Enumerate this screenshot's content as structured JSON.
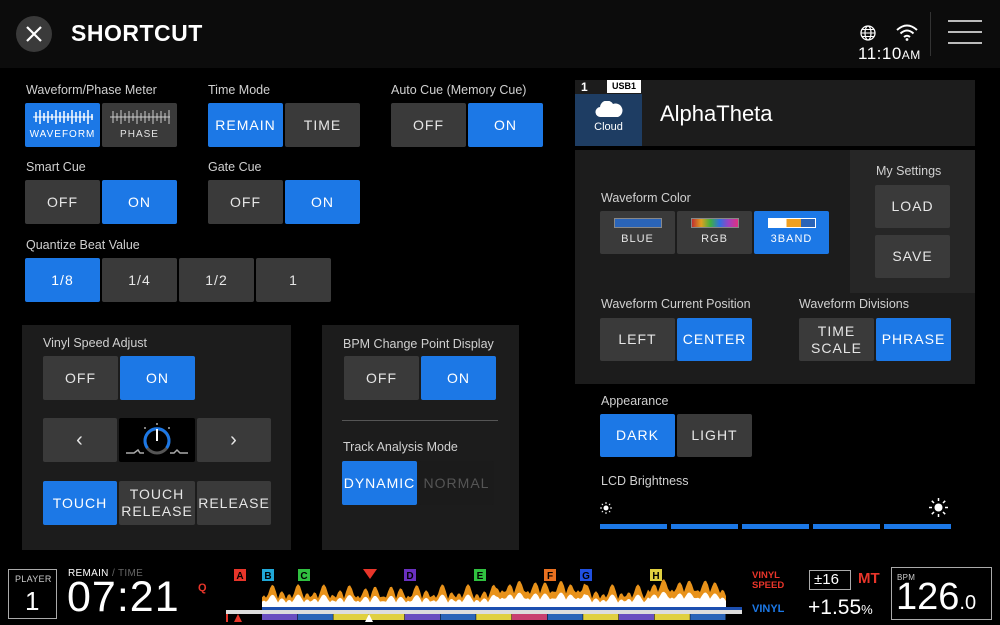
{
  "header": {
    "title": "SHORTCUT",
    "time": "11:10",
    "ampm": "AM"
  },
  "waveform_phase_meter": {
    "label": "Waveform/Phase Meter",
    "options": [
      "WAVEFORM",
      "PHASE"
    ],
    "selected": "WAVEFORM"
  },
  "time_mode": {
    "label": "Time Mode",
    "options": [
      "REMAIN",
      "TIME"
    ],
    "selected": "REMAIN"
  },
  "auto_cue": {
    "label": "Auto Cue (Memory Cue)",
    "options": [
      "OFF",
      "ON"
    ],
    "selected": "ON"
  },
  "smart_cue": {
    "label": "Smart Cue",
    "options": [
      "OFF",
      "ON"
    ],
    "selected": "ON"
  },
  "gate_cue": {
    "label": "Gate Cue",
    "options": [
      "OFF",
      "ON"
    ],
    "selected": "ON"
  },
  "quantize": {
    "label": "Quantize Beat Value",
    "options": [
      "1/8",
      "1/4",
      "1/2",
      "1"
    ],
    "selected": "1/8"
  },
  "vinyl_speed": {
    "label": "Vinyl Speed Adjust",
    "options": [
      "OFF",
      "ON"
    ],
    "selected": "ON",
    "prev": "‹",
    "next": "›",
    "modes": [
      "TOUCH",
      "TOUCH RELEASE",
      "RELEASE"
    ],
    "mode_selected": "TOUCH"
  },
  "bpm_change": {
    "label": "BPM Change Point Display",
    "options": [
      "OFF",
      "ON"
    ],
    "selected": "ON"
  },
  "track_analysis": {
    "label": "Track Analysis Mode",
    "options": [
      "DYNAMIC",
      "NORMAL"
    ],
    "selected": "DYNAMIC"
  },
  "deck": {
    "number": "1",
    "usb": "USB1",
    "source": "Cloud",
    "name": "AlphaTheta"
  },
  "waveform_color": {
    "label": "Waveform Color",
    "options": [
      "BLUE",
      "RGB",
      "3BAND"
    ],
    "selected": "3BAND"
  },
  "my_settings": {
    "label": "My Settings",
    "load": "LOAD",
    "save": "SAVE"
  },
  "waveform_position": {
    "label": "Waveform Current Position",
    "options": [
      "LEFT",
      "CENTER"
    ],
    "selected": "CENTER"
  },
  "waveform_divisions": {
    "label": "Waveform Divisions",
    "options": [
      "TIME SCALE",
      "PHRASE"
    ],
    "selected": "PHRASE"
  },
  "appearance": {
    "label": "Appearance",
    "options": [
      "DARK",
      "LIGHT"
    ],
    "selected": "DARK"
  },
  "lcd_brightness": {
    "label": "LCD Brightness",
    "level": 5,
    "max": 5
  },
  "status_bar": {
    "player_label": "PLAYER",
    "player_number": "1",
    "remain_label": "REMAIN",
    "time_label": "/ TIME",
    "time_value": "07:21",
    "quantize_q": "Q",
    "hot_cues": [
      "A",
      "B",
      "C",
      "D",
      "E",
      "F",
      "G",
      "H"
    ],
    "vinyl_speed": "VINYL SPEED",
    "vinyl": "VINYL",
    "tempo_range": "±16",
    "master_tempo": "MT",
    "tempo": "+1.55",
    "tempo_unit": "%",
    "bpm_label": "BPM",
    "bpm_int": "126",
    "bpm_dec": ".0",
    "position": 0.27
  },
  "colors": {
    "accent": "#1c78e6",
    "panel": "#1c1c1c",
    "button": "#3a3a3a",
    "red": "#e8352a"
  }
}
